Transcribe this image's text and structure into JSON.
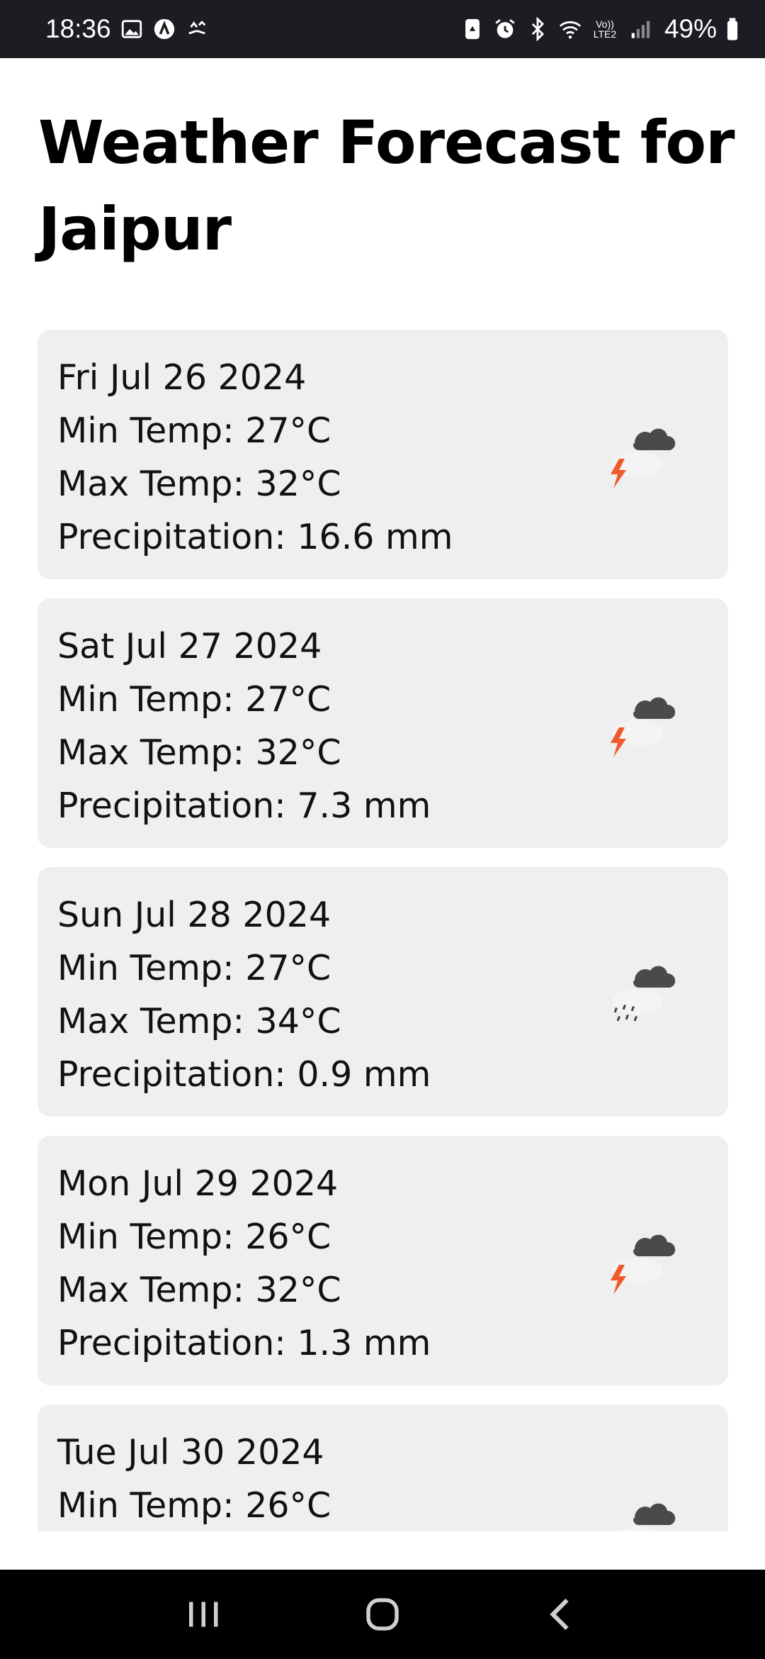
{
  "status_bar": {
    "time": "18:36",
    "left_icons": [
      "gallery-icon",
      "app-a-icon",
      "hand-icon"
    ],
    "right_icons": [
      "nfc-icon",
      "alarm-icon",
      "bluetooth-icon",
      "wifi-icon",
      "volte-icon",
      "signal-icon"
    ],
    "volte_label": "Vo)) LTE2",
    "battery": "49%"
  },
  "page": {
    "title": "Weather Forecast for Jaipur"
  },
  "forecast": [
    {
      "date": "Fri Jul 26 2024",
      "min": "Min Temp: 27°C",
      "max": "Max Temp: 32°C",
      "precip": "Precipitation: 16.6 mm",
      "icon": "thunderstorm-icon"
    },
    {
      "date": "Sat Jul 27 2024",
      "min": "Min Temp: 27°C",
      "max": "Max Temp: 32°C",
      "precip": "Precipitation: 7.3 mm",
      "icon": "thunderstorm-icon"
    },
    {
      "date": "Sun Jul 28 2024",
      "min": "Min Temp: 27°C",
      "max": "Max Temp: 34°C",
      "precip": "Precipitation: 0.9 mm",
      "icon": "rain-cloud-icon"
    },
    {
      "date": "Mon Jul 29 2024",
      "min": "Min Temp: 26°C",
      "max": "Max Temp: 32°C",
      "precip": "Precipitation: 1.3 mm",
      "icon": "thunderstorm-icon"
    },
    {
      "date": "Tue Jul 30 2024",
      "min": "Min Temp: 26°C",
      "max": "",
      "precip": "",
      "icon": "thunderstorm-icon"
    }
  ],
  "colors": {
    "status_bar_bg": "#1c1d22",
    "card_bg": "#efefef",
    "bolt": "#f05a2a",
    "cloud_dark": "#4a4a4a"
  },
  "nav_bar": {
    "buttons": [
      "recent-apps-icon",
      "home-icon",
      "back-icon"
    ]
  }
}
